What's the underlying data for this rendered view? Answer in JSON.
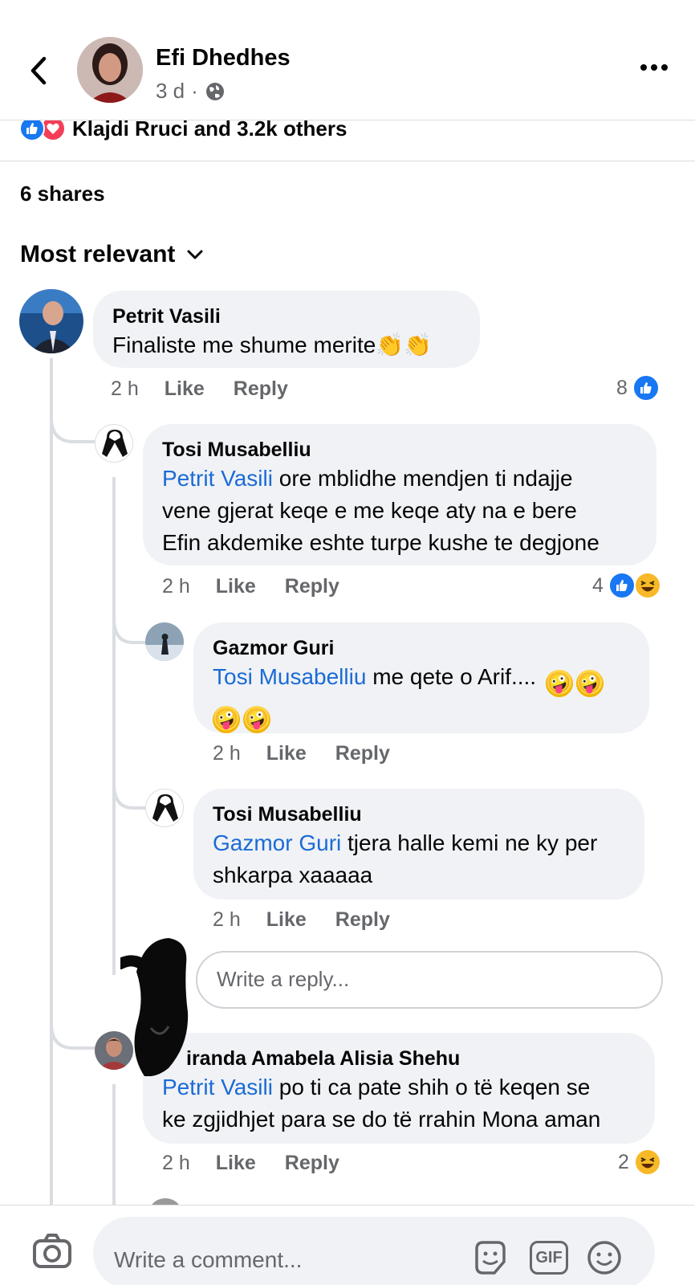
{
  "post": {
    "author": "Efi Dhedhes",
    "meta_time": "3 d",
    "meta_sep": "·",
    "reactions_text": "Klajdi Rruci and 3.2k others",
    "shares_text": "6 shares",
    "sort_label": "Most relevant"
  },
  "comments": [
    {
      "name": "Petrit Vasili",
      "text": "Finaliste me shume merite",
      "emoji": "👏👏",
      "time": "2 h",
      "like": "Like",
      "reply": "Reply",
      "reaction_count": "8"
    },
    {
      "name": "Tosi Musabelliu",
      "mention": "Petrit Vasili",
      "text_line1": " ore mblidhe mendjen ti ndajje",
      "text_line2": "vene gjerat keqe e me keqe aty na e bere",
      "text_line3": "Efin akdemike eshte turpe kushe te degjone",
      "time": "2 h",
      "like": "Like",
      "reply": "Reply",
      "reaction_count": "4"
    },
    {
      "name": "Gazmor Guri",
      "mention": "Tosi Musabelliu",
      "text": " me qete o Arif....",
      "time": "2 h",
      "like": "Like",
      "reply": "Reply"
    },
    {
      "name": "Tosi Musabelliu",
      "mention": "Gazmor Guri",
      "text_line1": " tjera halle kemi ne ky per",
      "text_line2": "shkarpa xaaaaa",
      "time": "2 h",
      "like": "Like",
      "reply": "Reply"
    },
    {
      "name": "Miranda Amabela Alisia Shehu",
      "name_visible": "iranda Amabela Alisia Shehu",
      "mention": "Petrit Vasili",
      "text_line1": " po ti ca pate shih o të keqen se",
      "text_line2": "ke zgjidhjet para se do të rrahin Mona aman",
      "time": "2 h",
      "like": "Like",
      "reply": "Reply",
      "reaction_count": "2"
    }
  ],
  "reply_input": {
    "placeholder": "Write a reply..."
  },
  "composer": {
    "placeholder": "Write a comment...",
    "gif_label": "GIF"
  },
  "colors": {
    "mention": "#1b6bd6",
    "like_blue": "#1877f2",
    "love_red": "#f33e58",
    "haha_yellow": "#f7b928",
    "bubble_bg": "#f0f2f5"
  },
  "icons": [
    "back-arrow-icon",
    "globe-icon",
    "more-icon",
    "like-reaction-icon",
    "love-reaction-icon",
    "chevron-down-icon",
    "haha-reaction-icon",
    "camera-icon",
    "sticker-icon",
    "gif-icon",
    "emoji-icon"
  ]
}
